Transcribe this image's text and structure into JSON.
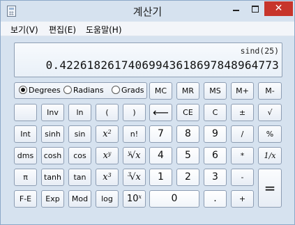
{
  "window": {
    "title": "계산기"
  },
  "menu": [
    {
      "key": "view",
      "label": "보기(V)"
    },
    {
      "key": "edit",
      "label": "편집(E)"
    },
    {
      "key": "help",
      "label": "도움말(H)"
    }
  ],
  "display": {
    "expression": "sind(25)",
    "value": "0.42261826174069943618697848964773"
  },
  "angle_modes": [
    {
      "key": "degrees",
      "label": "Degrees",
      "selected": true
    },
    {
      "key": "radians",
      "label": "Radians",
      "selected": false
    },
    {
      "key": "grads",
      "label": "Grads",
      "selected": false
    }
  ],
  "memory": [
    "MC",
    "MR",
    "MS",
    "M+",
    "M-"
  ],
  "buttons": {
    "inv": "Inv",
    "ln": "ln",
    "lparen": "(",
    "rparen": ")",
    "back": "⟵",
    "ce": "CE",
    "clear": "C",
    "pm": "±",
    "sqrt": "√",
    "int": "Int",
    "sinh": "sinh",
    "sin": "sin",
    "x2": "x",
    "x2_sup": "2",
    "fact": "n!",
    "n7": "7",
    "n8": "8",
    "n9": "9",
    "div": "/",
    "pct": "%",
    "dms": "dms",
    "cosh": "cosh",
    "cos": "cos",
    "xy": "x",
    "xy_sup": "y",
    "yroot": "x",
    "yroot_pre": "y",
    "yroot_sym": "√",
    "n4": "4",
    "n5": "5",
    "n6": "6",
    "mul": "*",
    "recip": "1/x",
    "pi": "π",
    "tanh": "tanh",
    "tan": "tan",
    "x3": "x",
    "x3_sup": "3",
    "croot": "x",
    "croot_pre": "3",
    "croot_sym": "√",
    "n1": "1",
    "n2": "2",
    "n3": "3",
    "sub": "-",
    "eq": "=",
    "fe": "F-E",
    "exp": "Exp",
    "mod": "Mod",
    "log": "log",
    "tenx": "10",
    "tenx_sup": "x",
    "n0": "0",
    "dot": ".",
    "add": "+"
  }
}
